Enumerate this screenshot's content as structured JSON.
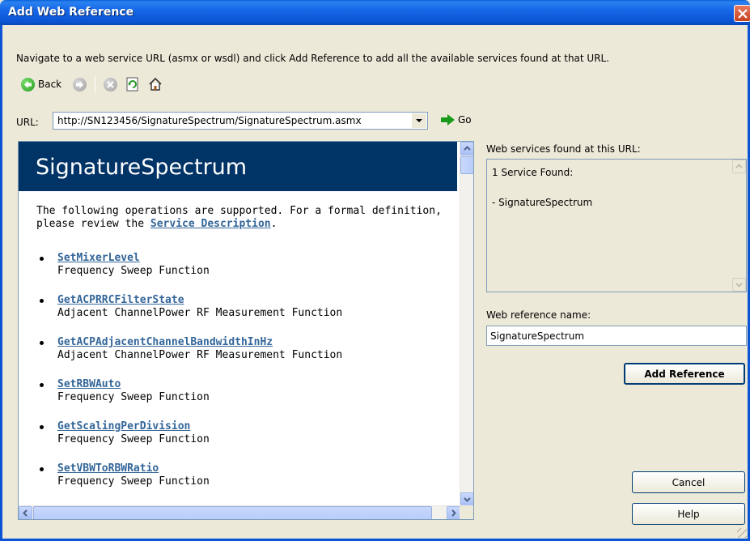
{
  "window": {
    "title": "Add Web Reference",
    "close_icon": "close-icon"
  },
  "instruction": "Navigate to a web service URL (asmx or wsdl) and click Add Reference to add all the available services found at that URL.",
  "toolbar": {
    "back_label": "Back",
    "icons": [
      "back-arrow-icon",
      "forward-arrow-icon",
      "stop-icon",
      "refresh-icon",
      "home-icon"
    ]
  },
  "url_bar": {
    "label": "URL:",
    "value": "http://SN123456/SignatureSpectrum/SignatureSpectrum.asmx",
    "go_label": "Go"
  },
  "browser": {
    "service_name": "SignatureSpectrum",
    "intro_text": "The following operations are supported. For a formal definition, please review the ",
    "intro_link": "Service Description",
    "intro_end": ".",
    "operations": [
      {
        "name": "SetMixerLevel",
        "description": "Frequency Sweep Function"
      },
      {
        "name": "GetACPRRCFilterState",
        "description": "Adjacent ChannelPower RF Measurement Function"
      },
      {
        "name": "GetACPAdjacentChannelBandwidthInHz",
        "description": "Adjacent ChannelPower RF Measurement Function"
      },
      {
        "name": "SetRBWAuto",
        "description": "Frequency Sweep Function"
      },
      {
        "name": "GetScalingPerDivision",
        "description": "Frequency Sweep Function"
      },
      {
        "name": "SetVBWToRBWRatio",
        "description": "Frequency Sweep Function"
      }
    ]
  },
  "services_panel": {
    "label": "Web services found at this URL:",
    "count_text": "1 Service Found:",
    "items": [
      "- SignatureSpectrum"
    ]
  },
  "reference": {
    "label": "Web reference name:",
    "value": "SignatureSpectrum"
  },
  "buttons": {
    "add_reference": "Add Reference",
    "cancel": "Cancel",
    "help": "Help"
  },
  "colors": {
    "title_bar": "#0b55d4",
    "banner": "#003366",
    "link": "#336699",
    "dialog_bg": "#ece9d8"
  }
}
